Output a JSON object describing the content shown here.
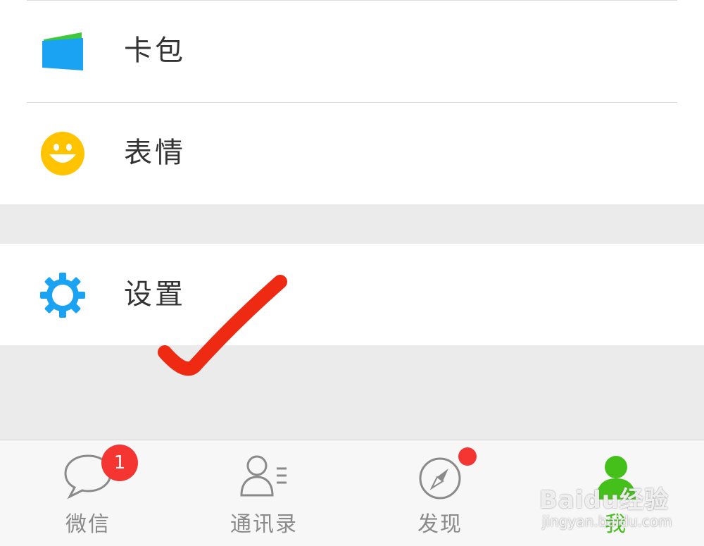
{
  "menu": {
    "group1": [
      {
        "label": "卡包",
        "icon": "card-wallet-icon"
      },
      {
        "label": "表情",
        "icon": "smiley-face-icon"
      }
    ],
    "group2": [
      {
        "label": "设置",
        "icon": "gear-icon"
      }
    ]
  },
  "tabbar": {
    "tabs": [
      {
        "label": "微信",
        "icon": "chat-bubble-icon",
        "badge": "1"
      },
      {
        "label": "通讯录",
        "icon": "contacts-icon"
      },
      {
        "label": "发现",
        "icon": "compass-icon",
        "dot": true
      },
      {
        "label": "我",
        "icon": "person-icon",
        "active": true
      }
    ]
  },
  "watermark": {
    "main": "Baidu经验",
    "sub": "jingyan.baidu.com"
  },
  "colors": {
    "accent_green": "#45c01a",
    "badge_red": "#f43531",
    "gear_blue": "#1aa3f2",
    "smiley_yellow": "#ffc300",
    "checkmark_red": "#ee2a12"
  }
}
